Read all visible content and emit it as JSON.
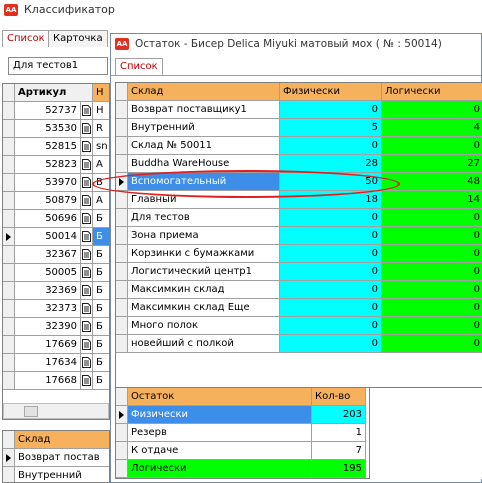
{
  "main_window": {
    "title": "Классификатор",
    "tabs": [
      "Список",
      "Карточка"
    ],
    "filter_value": "Для тестов1"
  },
  "left_table": {
    "headers": [
      "Артикул",
      "Н"
    ],
    "rows": [
      {
        "code": "52737",
        "name": "Н"
      },
      {
        "code": "53530",
        "name": "R"
      },
      {
        "code": "52815",
        "name": "sn"
      },
      {
        "code": "52823",
        "name": "А"
      },
      {
        "code": "53970",
        "name": "В"
      },
      {
        "code": "50879",
        "name": "А"
      },
      {
        "code": "50696",
        "name": "Б"
      },
      {
        "code": "50014",
        "name": "Б"
      },
      {
        "code": "32367",
        "name": "Б"
      },
      {
        "code": "50005",
        "name": "Б"
      },
      {
        "code": "32369",
        "name": "Б"
      },
      {
        "code": "32373",
        "name": "Б"
      },
      {
        "code": "32390",
        "name": "Б"
      },
      {
        "code": "17669",
        "name": "Б"
      },
      {
        "code": "17634",
        "name": "Б"
      },
      {
        "code": "17668",
        "name": "Б"
      }
    ]
  },
  "bottom_left": {
    "header": "Склад",
    "rows": [
      "Возврат постав",
      "Внутренний"
    ]
  },
  "dialog": {
    "title": "Остаток - Бисер Delica Miyuki матовый мох ( № : 50014)",
    "tab": "Список",
    "headers": [
      "Склад",
      "Физически",
      "Логически"
    ],
    "rows": [
      {
        "name": "Возврат поставщику1",
        "phys": "0",
        "log": "0"
      },
      {
        "name": "Внутренний",
        "phys": "5",
        "log": "4"
      },
      {
        "name": "Склад № 50011",
        "phys": "0",
        "log": "0"
      },
      {
        "name": "Buddha WareHouse",
        "phys": "28",
        "log": "27"
      },
      {
        "name": "Вспомогательный",
        "phys": "50",
        "log": "48"
      },
      {
        "name": "Главный",
        "phys": "18",
        "log": "14"
      },
      {
        "name": "Для тестов",
        "phys": "0",
        "log": "0"
      },
      {
        "name": "Зона приема",
        "phys": "0",
        "log": "0"
      },
      {
        "name": "Корзинки с бумажками",
        "phys": "0",
        "log": "0"
      },
      {
        "name": "Логистический центр1",
        "phys": "0",
        "log": "0"
      },
      {
        "name": "Максимкин склад",
        "phys": "0",
        "log": "0"
      },
      {
        "name": "Максимкин склад Еще",
        "phys": "0",
        "log": "0"
      },
      {
        "name": "Много полок",
        "phys": "0",
        "log": "0"
      },
      {
        "name": "новейший с полкой",
        "phys": "0",
        "log": "0"
      }
    ],
    "summary_headers": [
      "Остаток",
      "Кол-во"
    ],
    "summary_rows": [
      {
        "name": "Физически",
        "value": "203"
      },
      {
        "name": "Резерв",
        "value": "1"
      },
      {
        "name": "К отдаче",
        "value": "7"
      },
      {
        "name": "Логически",
        "value": "195"
      }
    ]
  },
  "colors": {
    "header": "#f6b15c",
    "physical": "#00ffff",
    "logical": "#00ff00",
    "selection": "#3d8ee8",
    "highlight": "#e02020"
  }
}
